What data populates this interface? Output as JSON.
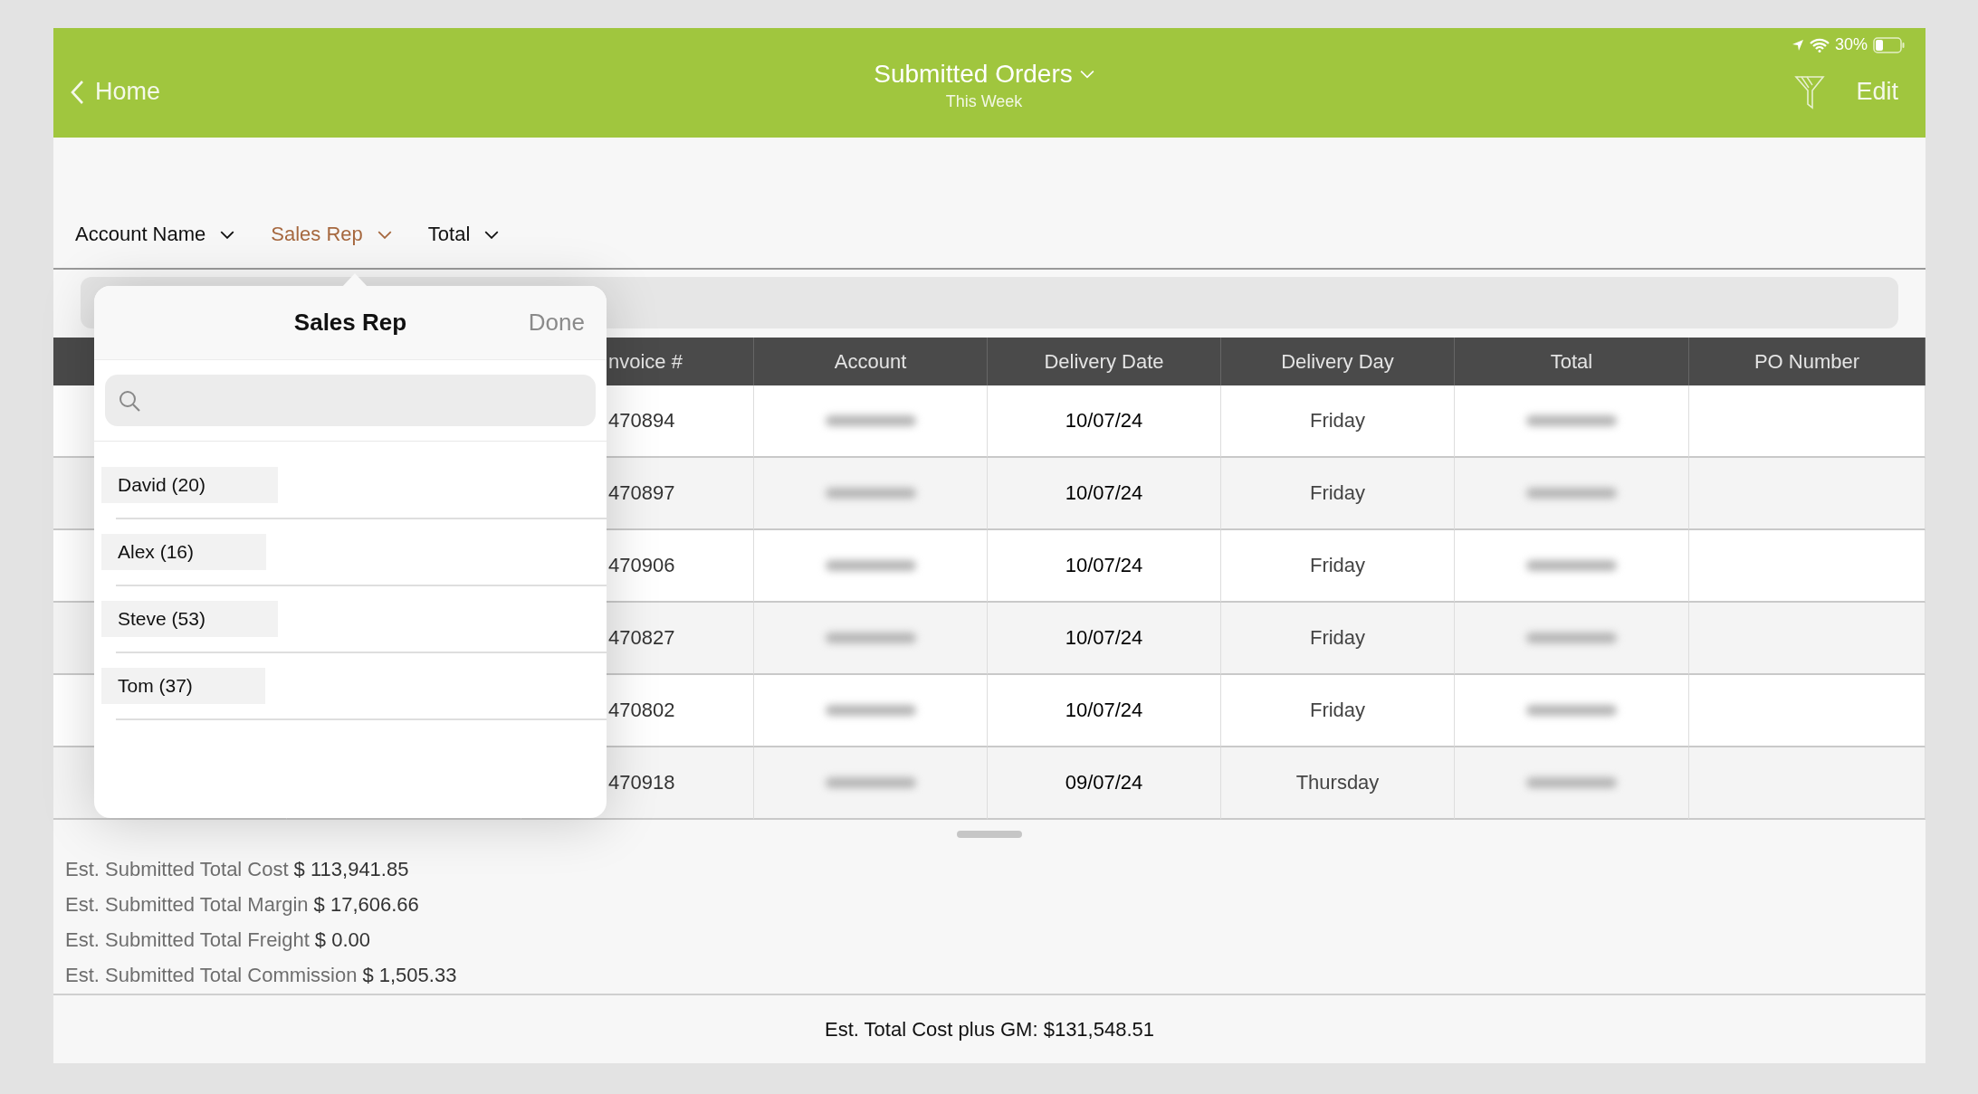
{
  "status_bar": {
    "battery": "30%"
  },
  "nav": {
    "back": "Home",
    "title": "Submitted Orders",
    "subtitle": "This Week",
    "action": "Edit"
  },
  "sort_options": [
    {
      "label": "Account Name",
      "selected": false
    },
    {
      "label": "Sales Rep",
      "selected": true
    },
    {
      "label": "Total",
      "selected": false
    }
  ],
  "table": {
    "columns": [
      "nvoice #",
      "Account",
      "Delivery Date",
      "Delivery Day",
      "Total",
      "PO Number"
    ],
    "rows": [
      {
        "invoice": "470894",
        "delivery_date": "10/07/24",
        "delivery_day": "Friday"
      },
      {
        "invoice": "470897",
        "delivery_date": "10/07/24",
        "delivery_day": "Friday"
      },
      {
        "invoice": "470906",
        "delivery_date": "10/07/24",
        "delivery_day": "Friday"
      },
      {
        "invoice": "470827",
        "delivery_date": "10/07/24",
        "delivery_day": "Friday"
      },
      {
        "invoice": "470802",
        "delivery_date": "10/07/24",
        "delivery_day": "Friday"
      },
      {
        "invoice": "470918",
        "delivery_date": "09/07/24",
        "delivery_day": "Thursday"
      }
    ]
  },
  "popover": {
    "title": "Sales Rep",
    "done": "Done",
    "items": [
      "David (20)",
      "Alex (16)",
      "Steve (53)",
      "Tom (37)"
    ]
  },
  "summary": [
    {
      "label": "Est. Submitted Total Cost",
      "value": "$ 113,941.85"
    },
    {
      "label": "Est. Submitted Total Margin",
      "value": "$ 17,606.66"
    },
    {
      "label": "Est. Submitted Total Freight",
      "value": "$ 0.00"
    },
    {
      "label": "Est. Submitted Total Commission",
      "value": "$ 1,505.33"
    }
  ],
  "footer": "Est. Total Cost plus GM: $131,548.51"
}
